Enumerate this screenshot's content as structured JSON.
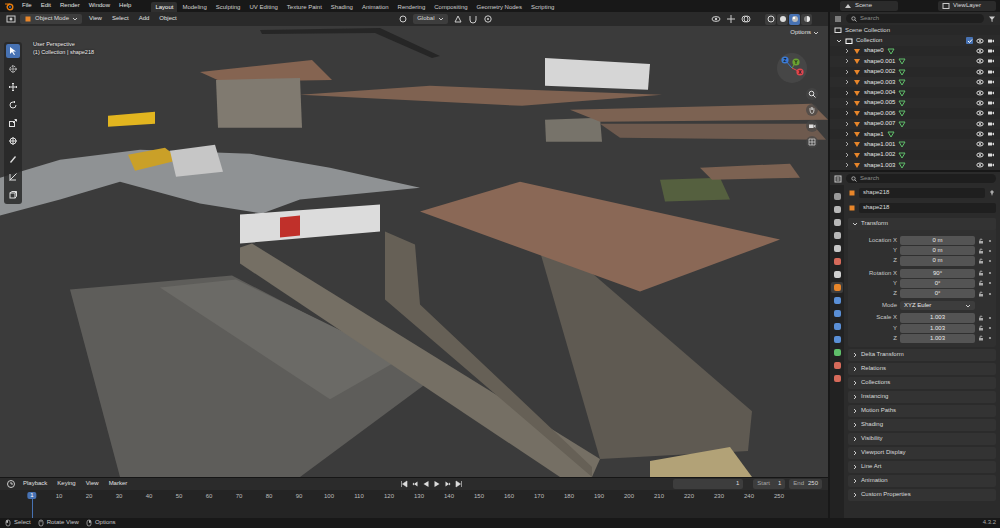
{
  "topbar": {
    "menus": [
      "File",
      "Edit",
      "Render",
      "Window",
      "Help"
    ],
    "workspaces": [
      {
        "label": "Layout",
        "selected": true
      },
      {
        "label": "Modeling",
        "selected": false
      },
      {
        "label": "Sculpting",
        "selected": false
      },
      {
        "label": "UV Editing",
        "selected": false
      },
      {
        "label": "Texture Paint",
        "selected": false
      },
      {
        "label": "Shading",
        "selected": false
      },
      {
        "label": "Animation",
        "selected": false
      },
      {
        "label": "Rendering",
        "selected": false
      },
      {
        "label": "Compositing",
        "selected": false
      },
      {
        "label": "Geometry Nodes",
        "selected": false
      },
      {
        "label": "Scripting",
        "selected": false
      }
    ],
    "scene": "Scene",
    "view_layer": "ViewLayer"
  },
  "viewport": {
    "mode": "Object Mode",
    "menus": [
      "View",
      "Select",
      "Add",
      "Object"
    ],
    "orientation": "Global",
    "options": "Options",
    "overlay_lines": [
      "User Perspective",
      "(1) Collection | shape218"
    ],
    "tools": [
      {
        "kind": "select",
        "selected": true
      },
      {
        "kind": "cursor",
        "selected": false
      },
      {
        "kind": "move",
        "selected": false
      },
      {
        "kind": "rotate",
        "selected": false
      },
      {
        "kind": "scale",
        "selected": false
      },
      {
        "kind": "transform",
        "selected": false
      },
      {
        "kind": "annotate",
        "selected": false
      },
      {
        "kind": "measure",
        "selected": false
      },
      {
        "kind": "add",
        "selected": false
      }
    ],
    "shading": [
      {
        "kind": "wireframe",
        "selected": false
      },
      {
        "kind": "solid",
        "selected": false
      },
      {
        "kind": "material",
        "selected": true
      },
      {
        "kind": "rendered",
        "selected": false
      }
    ],
    "gizmo_axes": [
      {
        "label": "X",
        "color": "#e0464f"
      },
      {
        "label": "Y",
        "color": "#6ba331"
      },
      {
        "label": "Z",
        "color": "#3b7bd6"
      }
    ]
  },
  "outliner": {
    "search_placeholder": "Search",
    "root": "Scene Collection",
    "collection": "Collection",
    "items": [
      {
        "name": "shape0",
        "visible": true
      },
      {
        "name": "shape0.001",
        "visible": true
      },
      {
        "name": "shape0.002",
        "visible": true
      },
      {
        "name": "shape0.003",
        "visible": true
      },
      {
        "name": "shape0.004",
        "visible": true
      },
      {
        "name": "shape0.005",
        "visible": true
      },
      {
        "name": "shape0.006",
        "visible": true
      },
      {
        "name": "shape0.007",
        "visible": true
      },
      {
        "name": "shape1",
        "visible": true
      },
      {
        "name": "shape1.001",
        "visible": true
      },
      {
        "name": "shape1.002",
        "visible": true
      },
      {
        "name": "shape1.003",
        "visible": true
      }
    ]
  },
  "properties": {
    "search_placeholder": "Search",
    "object_name": "shape218",
    "data_name": "shape218",
    "tabs": [
      {
        "kind": "tool",
        "color": "#9a9a9a",
        "selected": false
      },
      {
        "kind": "render",
        "color": "#b8b8b8",
        "selected": false
      },
      {
        "kind": "output",
        "color": "#b8b8b8",
        "selected": false
      },
      {
        "kind": "view-layer",
        "color": "#b8b8b8",
        "selected": false
      },
      {
        "kind": "scene",
        "color": "#c7c7c7",
        "selected": false
      },
      {
        "kind": "world",
        "color": "#d66a5a",
        "selected": false
      },
      {
        "kind": "collection",
        "color": "#d0d0d0",
        "selected": false
      },
      {
        "kind": "object",
        "color": "#e8862a",
        "selected": true
      },
      {
        "kind": "modifiers",
        "color": "#5a8fd6",
        "selected": false
      },
      {
        "kind": "particles",
        "color": "#5a8fd6",
        "selected": false
      },
      {
        "kind": "physics",
        "color": "#5a8fd6",
        "selected": false
      },
      {
        "kind": "constraints",
        "color": "#5a8fd6",
        "selected": false
      },
      {
        "kind": "data",
        "color": "#5fbf6a",
        "selected": false
      },
      {
        "kind": "material",
        "color": "#d66a5a",
        "selected": false
      },
      {
        "kind": "texture",
        "color": "#d66a5a",
        "selected": false
      }
    ],
    "transform": {
      "title": "Transform",
      "expanded": true,
      "groups": [
        {
          "rows": [
            {
              "label": "Location X",
              "value": "0 m",
              "kind": "field"
            },
            {
              "label": "Y",
              "value": "0 m",
              "kind": "field"
            },
            {
              "label": "Z",
              "value": "0 m",
              "kind": "field"
            }
          ]
        },
        {
          "rows": [
            {
              "label": "Rotation X",
              "value": "90°",
              "kind": "field"
            },
            {
              "label": "Y",
              "value": "0°",
              "kind": "field"
            },
            {
              "label": "Z",
              "value": "0°",
              "kind": "field"
            }
          ]
        },
        {
          "rows": [
            {
              "label": "Mode",
              "value": "XYZ Euler",
              "kind": "dropdown"
            }
          ]
        },
        {
          "rows": [
            {
              "label": "Scale X",
              "value": "1.003",
              "kind": "field"
            },
            {
              "label": "Y",
              "value": "1.003",
              "kind": "field"
            },
            {
              "label": "Z",
              "value": "1.003",
              "kind": "field"
            }
          ]
        }
      ]
    },
    "subpanels": [
      {
        "title": "Delta Transform",
        "expanded": false
      },
      {
        "title": "Relations",
        "expanded": false
      },
      {
        "title": "Collections",
        "expanded": false
      },
      {
        "title": "Instancing",
        "expanded": false
      },
      {
        "title": "Motion Paths",
        "expanded": false
      },
      {
        "title": "Shading",
        "expanded": false
      },
      {
        "title": "Visibility",
        "expanded": false
      },
      {
        "title": "Viewport Display",
        "expanded": false
      },
      {
        "title": "Line Art",
        "expanded": false
      },
      {
        "title": "Animation",
        "expanded": false
      },
      {
        "title": "Custom Properties",
        "expanded": false
      }
    ]
  },
  "timeline": {
    "menus": [
      "Playback",
      "Keying",
      "View",
      "Marker"
    ],
    "current_frame": "1",
    "start_label": "Start",
    "start": "1",
    "end_label": "End",
    "end": "250",
    "playhead": "1",
    "ticks": [
      "10",
      "20",
      "30",
      "40",
      "50",
      "60",
      "70",
      "80",
      "90",
      "100",
      "110",
      "120",
      "130",
      "140",
      "150",
      "160",
      "170",
      "180",
      "190",
      "200",
      "210",
      "220",
      "230",
      "240",
      "250"
    ]
  },
  "status_bar": {
    "hints": [
      "Select",
      "Rotate View",
      "Options"
    ],
    "version": "4.3.2"
  }
}
